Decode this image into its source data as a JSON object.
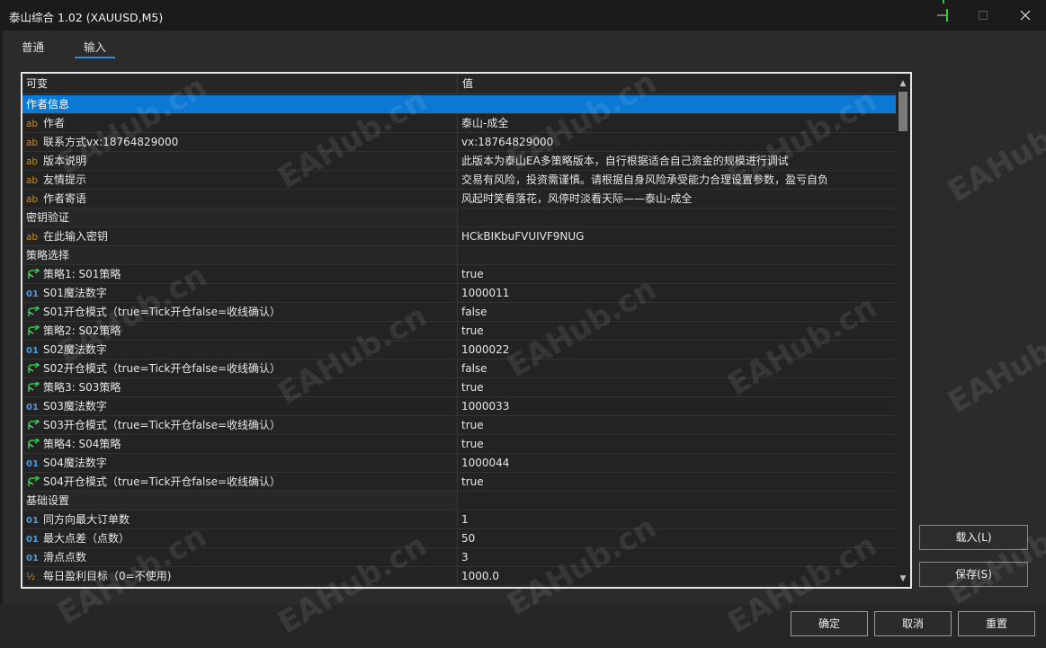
{
  "window": {
    "title": "泰山综合 1.02 (XAUUSD,M5)",
    "minimize_icon": "minimize-icon",
    "maximize_icon": "maximize-icon",
    "close_icon": "close-icon"
  },
  "tabs": [
    {
      "label": "普通",
      "active": false
    },
    {
      "label": "输入",
      "active": true
    }
  ],
  "grid": {
    "headers": {
      "variable": "可变",
      "value": "值"
    },
    "rows": [
      {
        "type": "group",
        "name": "作者信息",
        "value": ""
      },
      {
        "type": "string",
        "name": "作者",
        "value": "泰山-成全"
      },
      {
        "type": "string",
        "name": "联系方式vx:18764829000",
        "value": "vx:18764829000"
      },
      {
        "type": "string",
        "name": "版本说明",
        "value": "此版本为泰山EA多策略版本，自行根据适合自己资金的规模进行调试"
      },
      {
        "type": "string",
        "name": "友情提示",
        "value": "交易有风险，投资需谨慎。请根据自身风险承受能力合理设置参数，盈亏自负"
      },
      {
        "type": "string",
        "name": "作者寄语",
        "value": "风起时笑看落花，风停时淡看天际——泰山-成全"
      },
      {
        "type": "group",
        "name": "密钥验证",
        "value": ""
      },
      {
        "type": "string",
        "name": "在此输入密钥",
        "value": "HCkBIKbuFVUIVF9NUG"
      },
      {
        "type": "group",
        "name": "策略选择",
        "value": ""
      },
      {
        "type": "bool",
        "name": "策略1: S01策略",
        "value": "true"
      },
      {
        "type": "int",
        "name": "S01魔法数字",
        "value": "1000011"
      },
      {
        "type": "bool",
        "name": "S01开仓模式（true=Tick开仓false=收线确认）",
        "value": "false"
      },
      {
        "type": "bool",
        "name": "策略2: S02策略",
        "value": "true"
      },
      {
        "type": "int",
        "name": "S02魔法数字",
        "value": "1000022"
      },
      {
        "type": "bool",
        "name": "S02开仓模式（true=Tick开仓false=收线确认）",
        "value": "false"
      },
      {
        "type": "bool",
        "name": "策略3: S03策略",
        "value": "true"
      },
      {
        "type": "int",
        "name": "S03魔法数字",
        "value": "1000033"
      },
      {
        "type": "bool",
        "name": "S03开仓模式（true=Tick开仓false=收线确认）",
        "value": "true"
      },
      {
        "type": "bool",
        "name": "策略4: S04策略",
        "value": "true"
      },
      {
        "type": "int",
        "name": "S04魔法数字",
        "value": "1000044"
      },
      {
        "type": "bool",
        "name": "S04开仓模式（true=Tick开仓false=收线确认）",
        "value": "true"
      },
      {
        "type": "group",
        "name": "基础设置",
        "value": ""
      },
      {
        "type": "int",
        "name": "同方向最大订单数",
        "value": "1"
      },
      {
        "type": "int",
        "name": "最大点差（点数）",
        "value": "50"
      },
      {
        "type": "int",
        "name": "滑点点数",
        "value": "3"
      },
      {
        "type": "double",
        "name": "每日盈利目标（0=不使用)",
        "value": "1000.0"
      }
    ]
  },
  "icons": {
    "string": "ab",
    "int": "01",
    "double": "½",
    "bool": "bool-arrow-icon"
  },
  "side_buttons": {
    "load": "载入(L)",
    "save": "保存(S)"
  },
  "footer_buttons": {
    "ok": "确定",
    "cancel": "取消",
    "reset": "重置"
  },
  "watermark": "EAHub.cn",
  "colors": {
    "selection": "#0b78d4",
    "tab_underline": "#2f88d8",
    "string_icon": "#c98a2a",
    "int_icon": "#4c9be0",
    "bool_icon": "#29c94a"
  }
}
